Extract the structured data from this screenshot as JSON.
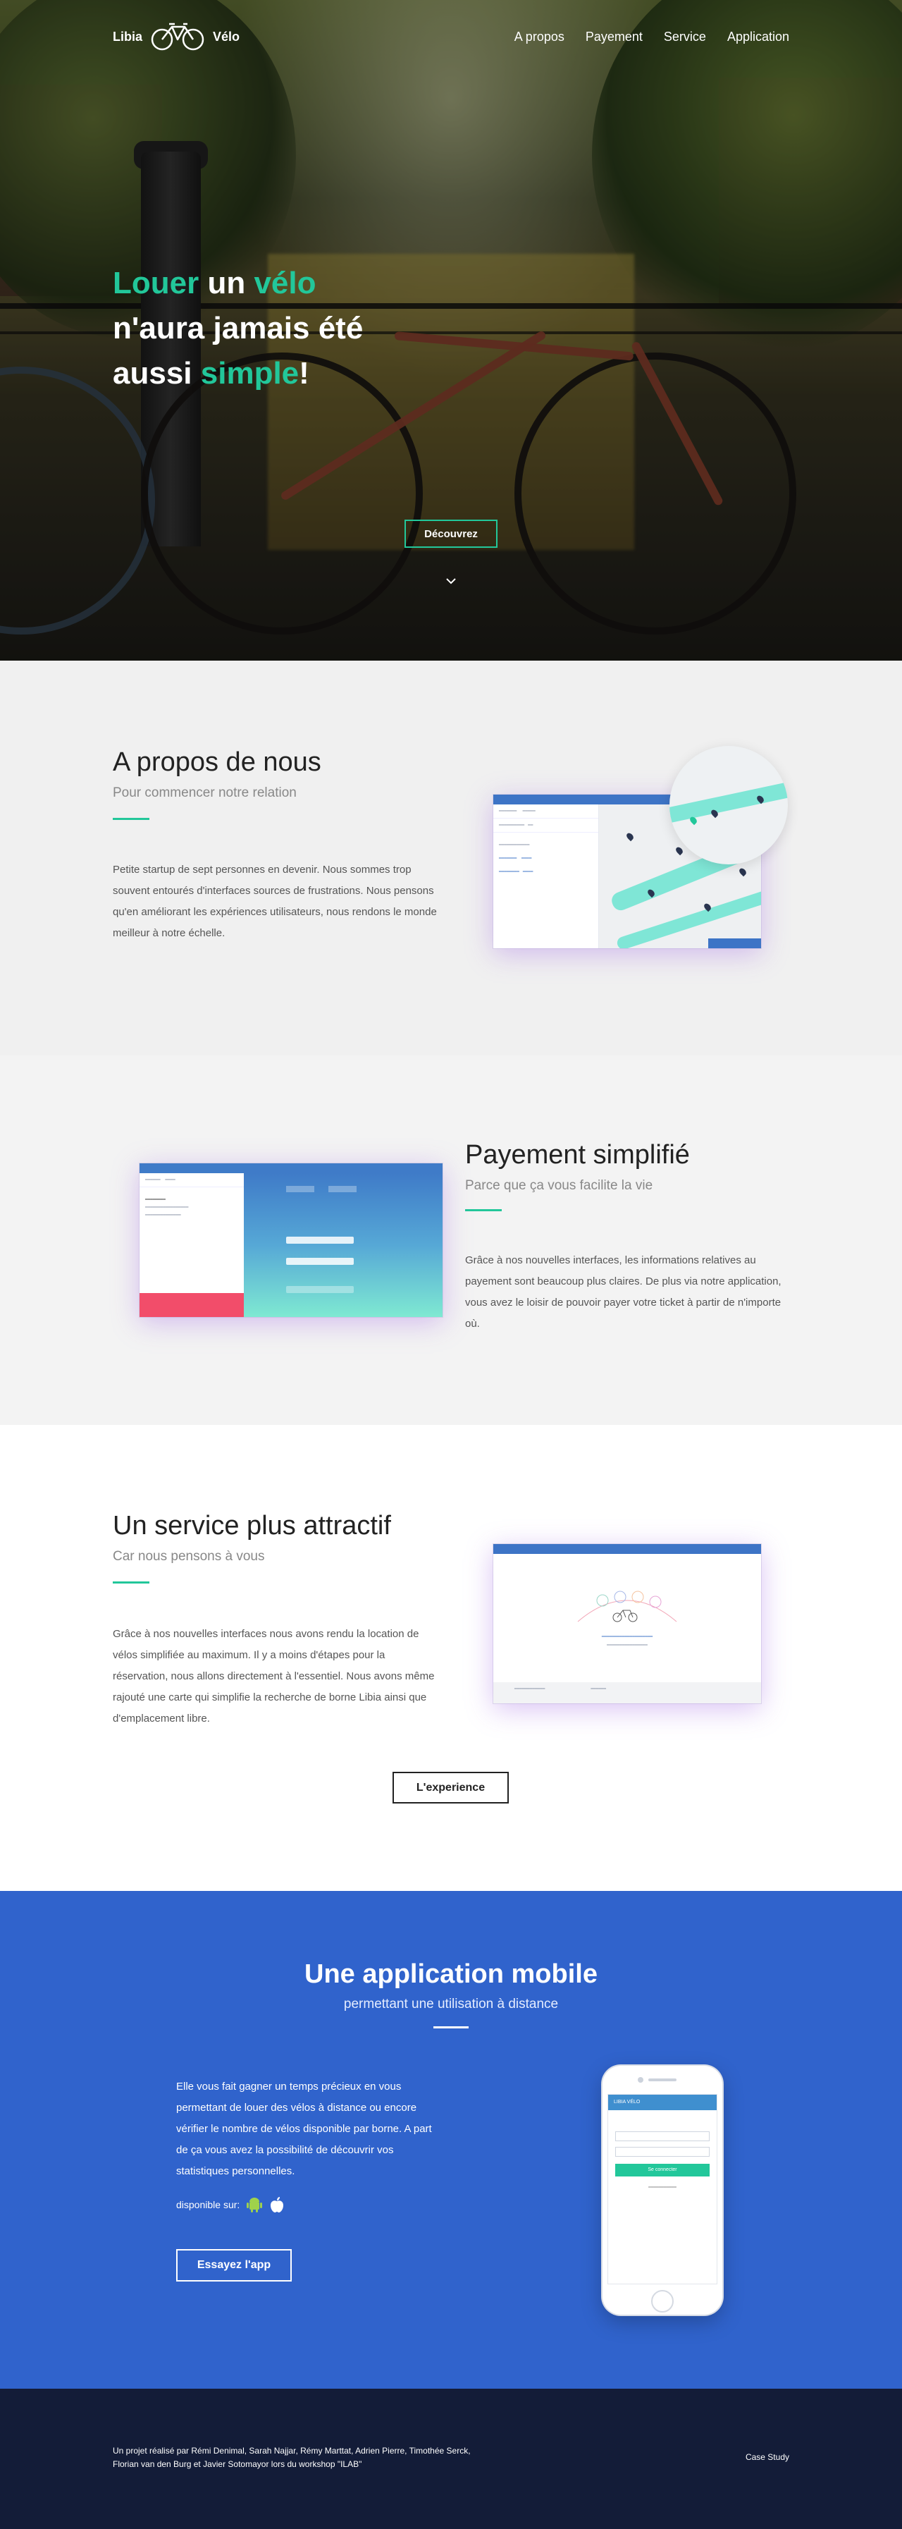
{
  "nav": {
    "logo_left": "Libia",
    "logo_right": "Vélo",
    "items": [
      "A propos",
      "Payement",
      "Service",
      "Application"
    ]
  },
  "hero": {
    "line1_a": "Louer",
    "line1_b": " un ",
    "line1_c": "vélo",
    "line2": "n'aura jamais été",
    "line3_a": "aussi ",
    "line3_b": "simple",
    "line3_c": "!",
    "button": "Découvrez"
  },
  "about": {
    "title": "A propos de nous",
    "subtitle": "Pour commencer notre relation",
    "body": "Petite startup de sept personnes en devenir. Nous sommes trop souvent entourés d'interfaces sources de frustrations. Nous pensons qu'en améliorant les expériences utilisateurs, nous rendons le monde meilleur à notre échelle."
  },
  "payment": {
    "title": "Payement simplifié",
    "subtitle": "Parce que ça vous facilite la vie",
    "body": "Grâce à nos nouvelles interfaces, les informations relatives au payement sont beaucoup plus claires. De plus via notre application, vous avez le loisir de pouvoir payer votre ticket à partir de n'importe où."
  },
  "service": {
    "title": "Un service plus attractif",
    "subtitle": "Car nous pensons à vous",
    "body": "Grâce à nos nouvelles interfaces nous avons rendu la location de vélos simplifiée au maximum. Il y a moins d'étapes pour la réservation, nous allons directement à l'essentiel. Nous avons même rajouté une carte qui simplifie la recherche de borne Libia ainsi que d'emplacement libre.",
    "button": "L'experience"
  },
  "app": {
    "title": "Une application mobile",
    "subtitle": "permettant une utilisation à distance",
    "body": "Elle vous fait gagner un temps précieux en vous permettant de louer des vélos à distance ou encore vérifier le nombre de vélos disponible par borne. A part de ça vous avez la possibilité de découvrir vos statistiques personnelles.",
    "available": "disponible sur:",
    "button": "Essayez l'app",
    "phone": {
      "header": "LIBIA VÉLO",
      "go": "Se connecter"
    }
  },
  "footer": {
    "credit": "Un projet réalisé par Rémi Denimal, Sarah Najjar, Rémy Marttat, Adrien Pierre, Timothée Serck, Florian van den Burg et Javier Sotomayor lors du workshop \"ILAB\"",
    "link": "Case Study"
  },
  "colors": {
    "accent": "#22c79a",
    "app_bg": "#3063cc",
    "footer_bg": "#131c38",
    "mock_blue": "#3d74c6",
    "alert_red": "#f24d6a"
  },
  "icons": [
    "bike-logo-icon",
    "chevron-down-icon",
    "android-icon",
    "apple-icon"
  ]
}
